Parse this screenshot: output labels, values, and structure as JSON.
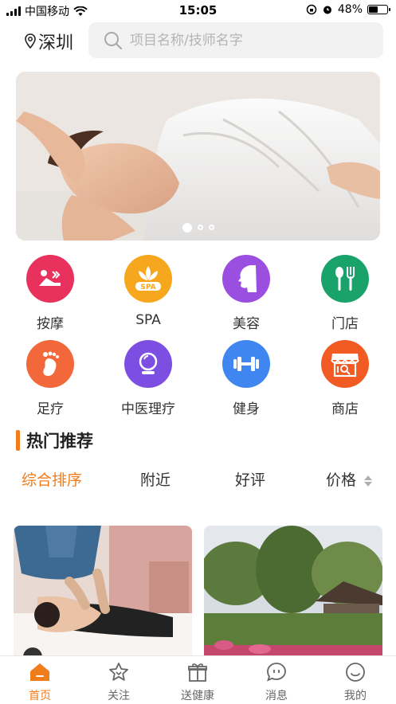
{
  "status_bar": {
    "carrier": "中国移动",
    "time": "15:05",
    "battery": "48%"
  },
  "header": {
    "city": "深圳",
    "search_placeholder": "项目名称/技师名字"
  },
  "banner": {
    "total_slides": 3,
    "active_slide": 1
  },
  "categories": [
    {
      "label": "按摩",
      "color": "#e8315d"
    },
    {
      "label": "SPA",
      "color": "#f6a71d"
    },
    {
      "label": "美容",
      "color": "#9b4fe0"
    },
    {
      "label": "门店",
      "color": "#19a36b"
    },
    {
      "label": "足疗",
      "color": "#f2683a"
    },
    {
      "label": "中医理疗",
      "color": "#7d4ee2"
    },
    {
      "label": "健身",
      "color": "#3f86f0"
    },
    {
      "label": "商店",
      "color": "#f25a23"
    }
  ],
  "section": {
    "title": "热门推荐"
  },
  "sorts": {
    "overall": "综合排序",
    "nearby": "附近",
    "rating": "好评",
    "price": "价格"
  },
  "tabbar": {
    "home": "首页",
    "follow": "关注",
    "gift": "送健康",
    "messages": "消息",
    "mine": "我的"
  },
  "colors": {
    "accent": "#f07c1c"
  }
}
